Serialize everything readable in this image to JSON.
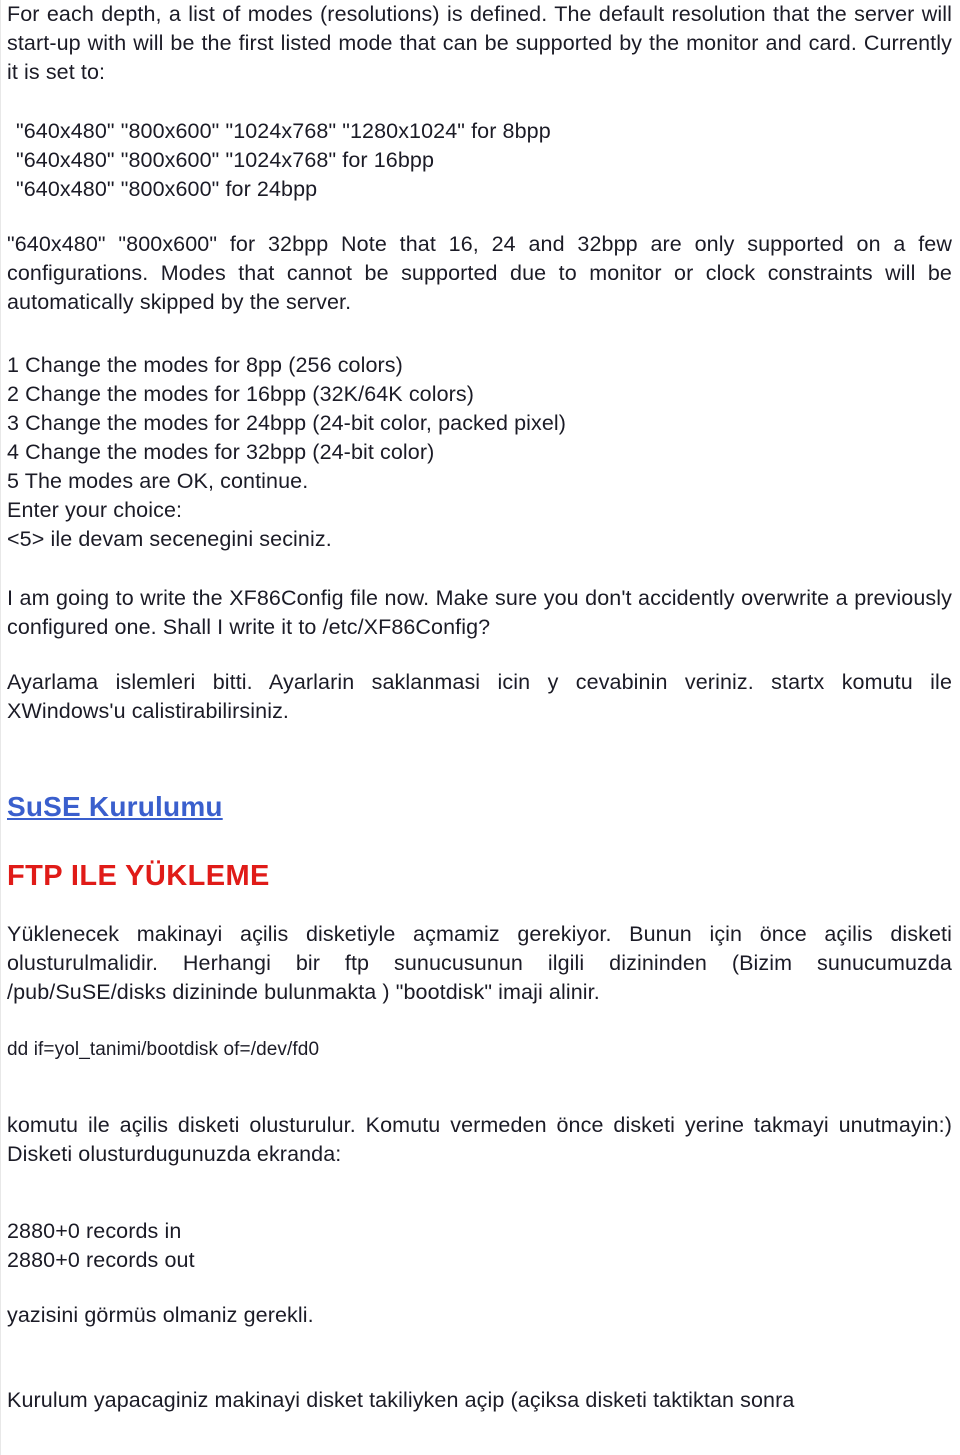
{
  "document": {
    "colors": {
      "text": "#1b1b26",
      "link": "#3a5fcd",
      "heading_red": "#e01b18",
      "background": "#ffffff"
    },
    "blocks": {
      "intro_paragraph": "For each depth, a list of modes (resolutions) is defined. The default resolution that the server will start-up with will be the first listed mode that can be supported by the monitor and card. Currently it is set to:",
      "mode_line_8bpp": "\"640x480\" \"800x600\" \"1024x768\" \"1280x1024\" for 8bpp",
      "mode_line_16bpp": "\"640x480\" \"800x600\" \"1024x768\" for 16bpp",
      "mode_line_24bpp": "\"640x480\" \"800x600\" for 24bpp",
      "mode_note_paragraph": "\"640x480\" \"800x600\" for 32bpp Note that 16, 24 and 32bpp are only supported on a few configurations. Modes that cannot be supported due to monitor or clock constraints will be automatically skipped by the server.",
      "menu_option_1": "1 Change the modes for 8pp (256 colors)",
      "menu_option_2": "2 Change the modes for 16bpp (32K/64K colors)",
      "menu_option_3": "3 Change the modes for 24bpp (24-bit color, packed pixel)",
      "menu_option_4": "4 Change the modes for 32bpp (24-bit color)",
      "menu_option_5": "5 The modes are OK, continue.",
      "enter_choice_prompt": "Enter your choice:",
      "choice_note_tr": "<5> ile devam secenegini seciniz.",
      "write_config_paragraph": "I am going to write the XF86Config file now. Make sure you don't accidently overwrite a previously configured one. Shall I write it to /etc/XF86Config?",
      "settings_done_paragraph": "Ayarlama islemleri bitti. Ayarlarin saklanmasi icin y cevabinin veriniz. startx komutu ile XWindows'u calistirabilirsiniz.",
      "suse_link_label": "SuSE Kurulumu",
      "ftp_heading": "FTP ILE YÜKLEME",
      "boot_disk_paragraph": "Yüklenecek makinayi açilis disketiyle açmamiz gerekiyor. Bunun için önce açilis disketi olusturulmalidir. Herhangi bir ftp sunucusunun ilgili dizininden (Bizim sunucumuzda /pub/SuSE/disks dizininde bulunmakta ) \"bootdisk\" imaji alinir.",
      "dd_command": "dd if=yol_tanimi/bootdisk of=/dev/fd0",
      "after_dd_paragraph": "komutu ile açilis disketi olusturulur. Komutu vermeden önce disketi yerine takmayi unutmayin:) Disketi olusturdugunuzda ekranda:",
      "records_in": "2880+0 records in",
      "records_out": "2880+0 records out",
      "records_note": "yazisini görmüs olmaniz gerekli.",
      "last_paragraph": "Kurulum yapacaginiz makinayi disket takiliyken açip (açiksa disketi taktiktan sonra"
    }
  }
}
